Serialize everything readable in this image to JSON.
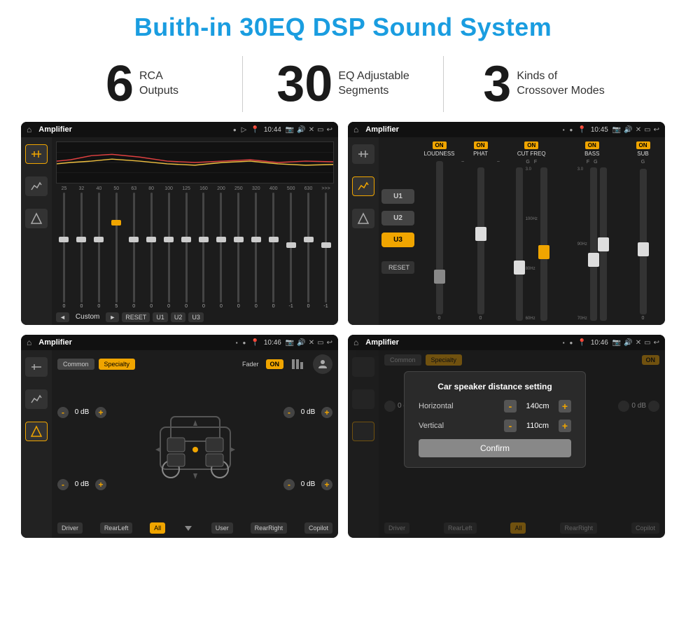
{
  "page": {
    "title": "Buith-in 30EQ DSP Sound System",
    "stats": [
      {
        "number": "6",
        "text_line1": "RCA",
        "text_line2": "Outputs"
      },
      {
        "number": "30",
        "text_line1": "EQ Adjustable",
        "text_line2": "Segments"
      },
      {
        "number": "3",
        "text_line1": "Kinds of",
        "text_line2": "Crossover Modes"
      }
    ]
  },
  "screens": {
    "eq": {
      "app_name": "Amplifier",
      "time": "10:44",
      "freq_labels": [
        "25",
        "32",
        "40",
        "50",
        "63",
        "80",
        "100",
        "125",
        "160",
        "200",
        "250",
        "320",
        "400",
        "500",
        "630"
      ],
      "slider_values": [
        "0",
        "0",
        "0",
        "5",
        "0",
        "0",
        "0",
        "0",
        "0",
        "0",
        "0",
        "0",
        "0",
        "-1",
        "0",
        "-1"
      ],
      "bottom_buttons": [
        "◄",
        "Custom",
        "►",
        "RESET",
        "U1",
        "U2",
        "U3"
      ]
    },
    "crossover": {
      "app_name": "Amplifier",
      "time": "10:45",
      "u_buttons": [
        "U1",
        "U2",
        "U3"
      ],
      "u_active": "U3",
      "channels": [
        "LOUDNESS",
        "PHAT",
        "CUT FREQ",
        "BASS",
        "SUB"
      ],
      "on_labels": [
        "ON",
        "ON",
        "ON",
        "ON",
        "ON"
      ],
      "reset_btn": "RESET"
    },
    "fader": {
      "app_name": "Amplifier",
      "time": "10:46",
      "tabs": [
        "Common",
        "Specialty"
      ],
      "active_tab": "Specialty",
      "fader_label": "Fader",
      "fader_on": "ON",
      "db_values": [
        "0 dB",
        "0 dB",
        "0 dB",
        "0 dB"
      ],
      "bottom_buttons": [
        "Driver",
        "RearLeft",
        "All",
        "User",
        "RearRight",
        "Copilot"
      ]
    },
    "dialog": {
      "app_name": "Amplifier",
      "time": "10:46",
      "dialog_title": "Car speaker distance setting",
      "horizontal_label": "Horizontal",
      "horizontal_value": "140cm",
      "vertical_label": "Vertical",
      "vertical_value": "110cm",
      "confirm_btn": "Confirm",
      "tabs": [
        "Common",
        "Specialty"
      ],
      "db_values": [
        "0 dB",
        "0 dB"
      ],
      "bottom_buttons": [
        "Driver",
        "RearLeft",
        "All",
        "RearRight",
        "Copilot"
      ],
      "fader_on": "ON"
    }
  }
}
